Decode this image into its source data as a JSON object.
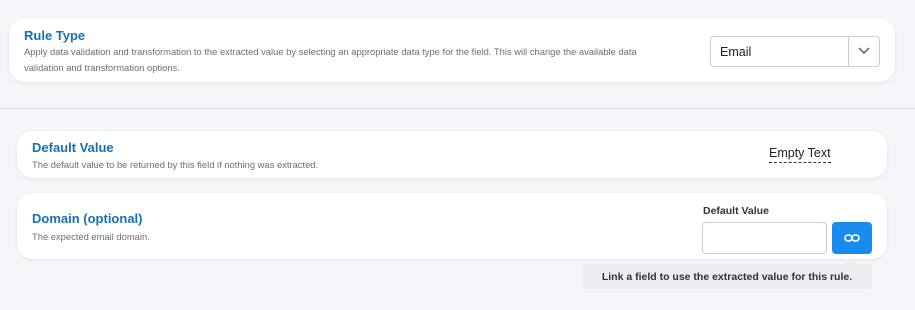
{
  "rule_type": {
    "title": "Rule Type",
    "description": "Apply data validation and transformation to the extracted value by selecting an appropriate data type for the field. This will change the available data validation and transformation options.",
    "select_value": "Email"
  },
  "default_value": {
    "title": "Default Value",
    "description": "The default value to be returned by this field if nothing was extracted.",
    "value": "Empty Text"
  },
  "domain": {
    "title": "Domain (optional)",
    "description": "The expected email domain.",
    "field_label": "Default Value",
    "input_value": "",
    "link_icon": "link-icon",
    "tooltip": "Link a field to use the extracted value for this rule."
  },
  "colors": {
    "title": "#1572b6",
    "accent_button": "#1a8cf0",
    "background": "#f5f6f9"
  }
}
